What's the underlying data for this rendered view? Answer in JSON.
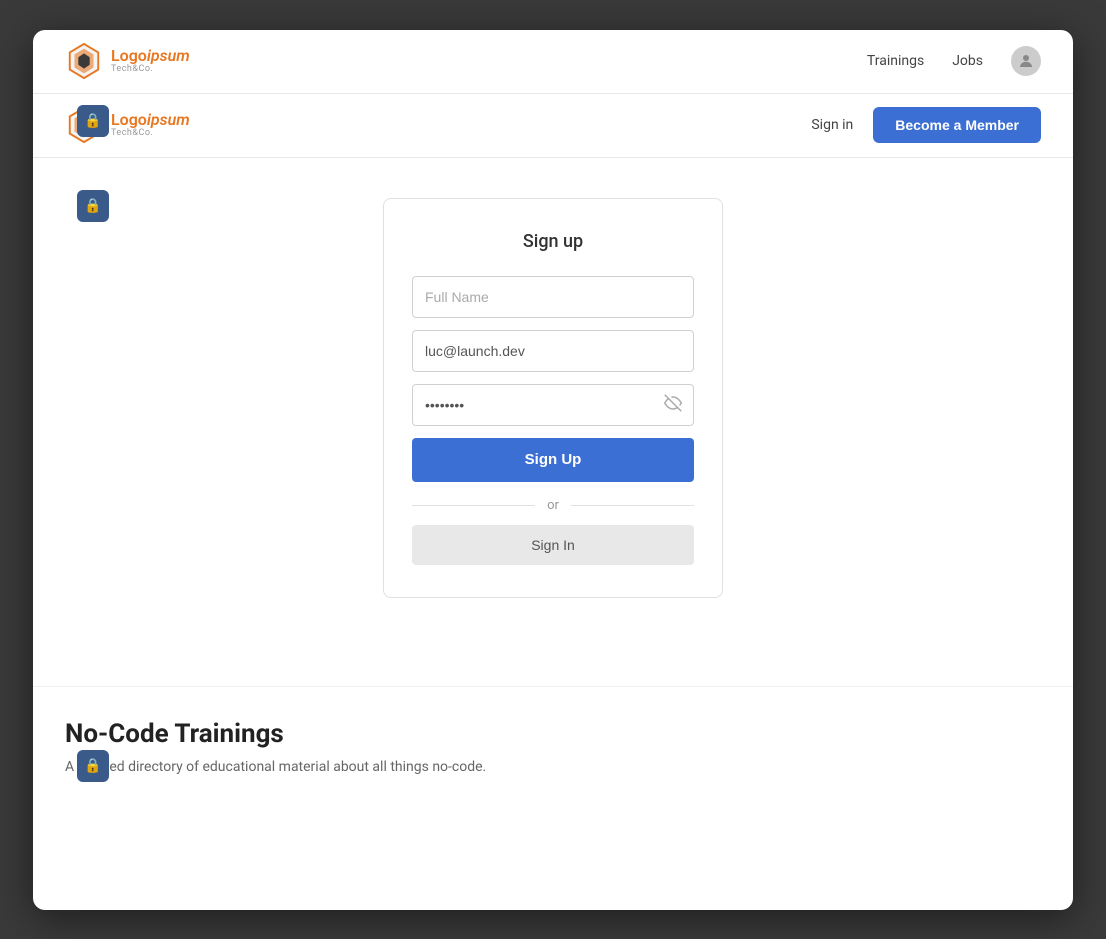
{
  "app": {
    "title": "LogoIpsum Tech&Co.",
    "logo_main": "Logo",
    "logo_italic": "ipsum",
    "logo_sub": "Tech&Co."
  },
  "navbar1": {
    "trainings_label": "Trainings",
    "jobs_label": "Jobs"
  },
  "navbar2": {
    "signin_label": "Sign in",
    "become_member_label": "Become a Member"
  },
  "signup_form": {
    "title": "Sign up",
    "fullname_placeholder": "Full Name",
    "email_value": "luc@launch.dev",
    "password_value": "••••••••",
    "signup_button": "Sign Up",
    "or_text": "or",
    "signin_button": "Sign In"
  },
  "bottom": {
    "title": "No-Code Trainings",
    "description": "A curated directory of educational material about all things no-code."
  },
  "icons": {
    "lock": "🔒",
    "eye_slash": "👁"
  }
}
